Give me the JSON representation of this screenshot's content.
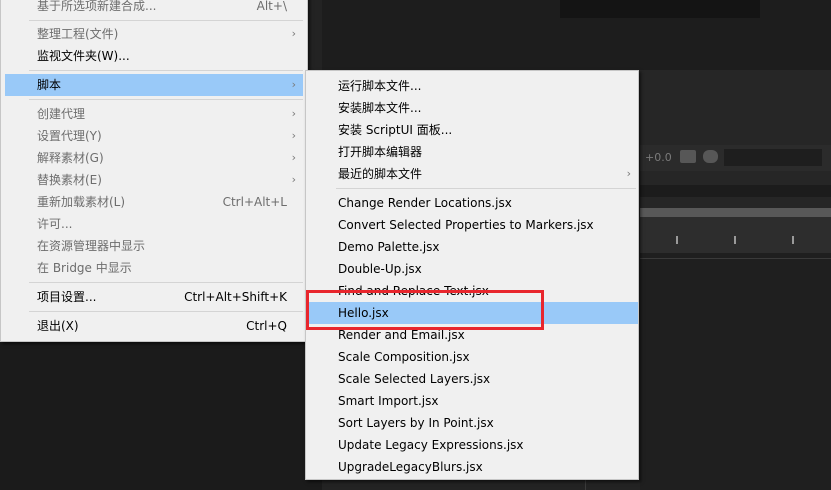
{
  "main_menu": {
    "items": [
      {
        "label": "基于所选项新建合成...",
        "shortcut": "Alt+\\",
        "disabled": true,
        "submenu": false
      },
      {
        "label": "整理工程(文件)",
        "shortcut": "",
        "disabled": true,
        "submenu": true
      },
      {
        "label": "监视文件夹(W)...",
        "shortcut": "",
        "disabled": false,
        "submenu": false
      },
      {
        "label": "脚本",
        "shortcut": "",
        "disabled": false,
        "submenu": true,
        "highlighted": true
      },
      {
        "label": "创建代理",
        "shortcut": "",
        "disabled": true,
        "submenu": true
      },
      {
        "label": "设置代理(Y)",
        "shortcut": "",
        "disabled": true,
        "submenu": true
      },
      {
        "label": "解释素材(G)",
        "shortcut": "",
        "disabled": true,
        "submenu": true
      },
      {
        "label": "替换素材(E)",
        "shortcut": "",
        "disabled": true,
        "submenu": true
      },
      {
        "label": "重新加载素材(L)",
        "shortcut": "Ctrl+Alt+L",
        "disabled": true,
        "submenu": false
      },
      {
        "label": "许可...",
        "shortcut": "",
        "disabled": true,
        "submenu": false
      },
      {
        "label": "在资源管理器中显示",
        "shortcut": "",
        "disabled": true,
        "submenu": false
      },
      {
        "label": "在 Bridge 中显示",
        "shortcut": "",
        "disabled": true,
        "submenu": false
      },
      {
        "label": "项目设置...",
        "shortcut": "Ctrl+Alt+Shift+K",
        "disabled": false,
        "submenu": false
      },
      {
        "label": "退出(X)",
        "shortcut": "Ctrl+Q",
        "disabled": false,
        "submenu": false
      }
    ]
  },
  "script_submenu": {
    "items": [
      {
        "label": "运行脚本文件...",
        "submenu": false
      },
      {
        "label": "安装脚本文件...",
        "submenu": false
      },
      {
        "label": "安装 ScriptUI 面板...",
        "submenu": false
      },
      {
        "label": "打开脚本编辑器",
        "submenu": false
      },
      {
        "label": "最近的脚本文件",
        "submenu": true
      },
      {
        "label": "Change Render Locations.jsx",
        "submenu": false
      },
      {
        "label": "Convert Selected Properties to Markers.jsx",
        "submenu": false
      },
      {
        "label": "Demo Palette.jsx",
        "submenu": false
      },
      {
        "label": "Double-Up.jsx",
        "submenu": false
      },
      {
        "label": "Find and Replace Text.jsx",
        "submenu": false
      },
      {
        "label": "Hello.jsx",
        "submenu": false,
        "highlighted": true
      },
      {
        "label": "Render and Email.jsx",
        "submenu": false
      },
      {
        "label": "Scale Composition.jsx",
        "submenu": false
      },
      {
        "label": "Scale Selected Layers.jsx",
        "submenu": false
      },
      {
        "label": "Smart Import.jsx",
        "submenu": false
      },
      {
        "label": "Sort Layers by In Point.jsx",
        "submenu": false
      },
      {
        "label": "Update Legacy Expressions.jsx",
        "submenu": false
      },
      {
        "label": "UpgradeLegacyBlurs.jsx",
        "submenu": false
      }
    ]
  },
  "background": {
    "offset_label": "+0.0"
  },
  "colors": {
    "menu_bg": "#f0f0f0",
    "highlight": "#99c9f8",
    "disabled_text": "#6d6d6d",
    "annotation": "#e8262d",
    "app_bg": "#232323"
  }
}
